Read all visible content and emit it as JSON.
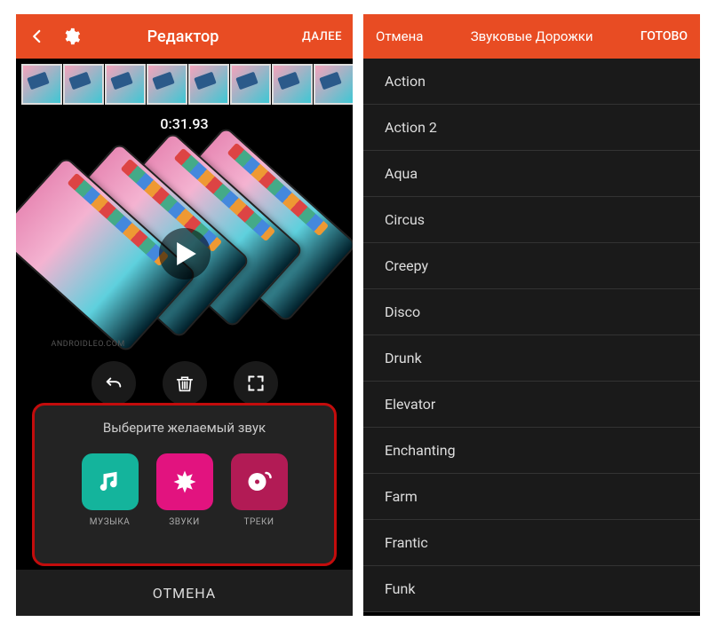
{
  "left": {
    "header": {
      "title": "Редактор",
      "next": "ДАЛЕЕ"
    },
    "timecode": "0:31.93",
    "watermark": "ANDROIDLEO.COM",
    "sound_panel": {
      "heading": "Выберите желаемый звук",
      "options": [
        {
          "label": "МУЗЫКА"
        },
        {
          "label": "ЗВУКИ"
        },
        {
          "label": "ТРЕКИ"
        }
      ]
    },
    "bottom_cancel": "ОТМЕНА"
  },
  "right": {
    "header": {
      "cancel": "Отмена",
      "title": "Звуковые Дорожки",
      "done": "ГОТОВО"
    },
    "tracks": [
      "Action",
      "Action 2",
      "Aqua",
      "Circus",
      "Creepy",
      "Disco",
      "Drunk",
      "Elevator",
      "Enchanting",
      "Farm",
      "Frantic",
      "Funk"
    ]
  }
}
